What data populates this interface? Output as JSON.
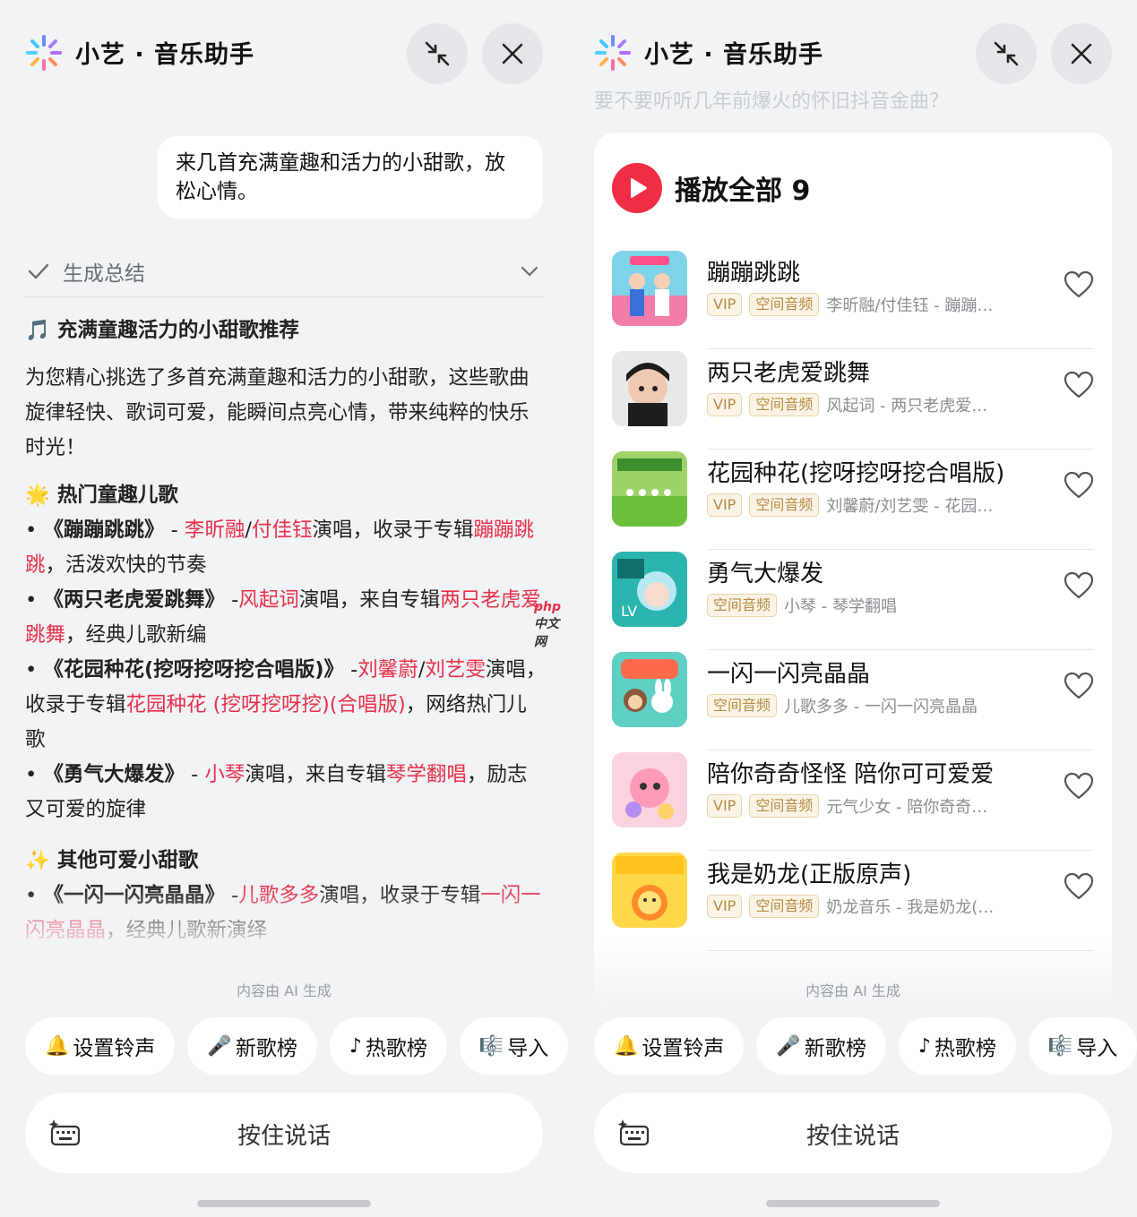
{
  "app": {
    "title": "小艺 · 音乐助手",
    "minimize_icon": "collapse-arrows-icon",
    "close_icon": "close-icon",
    "logo_icon": "sparkle-logo-icon"
  },
  "left": {
    "user_message": "来几首充满童趣和活力的小甜歌，放松心情。",
    "summary_label": "生成总结",
    "heading": "🎵 充满童趣活力的小甜歌推荐",
    "intro": "为您精心挑选了多首充满童趣和活力的小甜歌，这些歌曲旋律轻快、歌词可爱，能瞬间点亮心情，带来纯粹的快乐时光！",
    "section1_title": "🌟 热门童趣儿歌",
    "items": [
      {
        "bullet": "• ",
        "title": "《蹦蹦跳跳》",
        "dash": " - ",
        "artist1": "李昕融",
        "sep": "/",
        "artist2": "付佳钰",
        "mid": "演唱，收录于专辑",
        "album": "蹦蹦跳跳",
        "tail": "，活泼欢快的节奏"
      },
      {
        "bullet": "• ",
        "title": "《两只老虎爱跳舞》",
        "dash": " -",
        "artist1": "风起词",
        "sep": "",
        "artist2": "",
        "mid": "演唱，来自专辑",
        "album": "两只老虎爱跳舞",
        "tail": "，经典儿歌新编"
      },
      {
        "bullet": "• ",
        "title": "《花园种花(挖呀挖呀挖合唱版)》",
        "dash": " -",
        "artist1": "刘馨蔚",
        "sep": "/",
        "artist2": "刘艺雯",
        "mid": "演唱，收录于专辑",
        "album": "花园种花 (挖呀挖呀挖)(合唱版)",
        "tail": "，网络热门儿歌"
      },
      {
        "bullet": "• ",
        "title": "《勇气大爆发》",
        "dash": " - ",
        "artist1": "小琴",
        "sep": "",
        "artist2": "",
        "mid": "演唱，来自专辑",
        "album": "琴学翻唱",
        "tail": "，励志又可爱的旋律"
      }
    ],
    "section2_title": "✨ 其他可爱小甜歌",
    "items2": [
      {
        "bullet": "• ",
        "title": "《一闪一闪亮晶晶》",
        "dash": " -",
        "artist1": "儿歌多多",
        "sep": "",
        "artist2": "",
        "mid": "演唱，收录于专辑",
        "album": "一闪一闪亮晶晶",
        "tail": "，经典儿歌新演绎"
      }
    ],
    "watermark": "php",
    "watermark2": "中文网"
  },
  "right": {
    "ghost_text": "要不要听听几年前爆火的怀旧抖音金曲？",
    "play_all": "播放全部 9",
    "songs": [
      {
        "title": "蹦蹦跳跳",
        "vip": "VIP",
        "spatial": "空间音频",
        "meta": "李昕融/付佳钰 - 蹦蹦…",
        "cover": "cover-kids-dance"
      },
      {
        "title": "两只老虎爱跳舞",
        "vip": "VIP",
        "spatial": "空间音频",
        "meta": "风起词 - 两只老虎爱…",
        "cover": "cover-boy-portrait"
      },
      {
        "title": "花园种花(挖呀挖呀挖合唱版)",
        "vip": "VIP",
        "spatial": "空间音频",
        "meta": "刘馨蔚/刘艺雯 - 花园…",
        "cover": "cover-flower-garden"
      },
      {
        "title": "勇气大爆发",
        "vip": "",
        "spatial": "空间音频",
        "meta": "小琴 - 琴学翻唱",
        "cover": "cover-anime-girl"
      },
      {
        "title": "一闪一闪亮晶晶",
        "vip": "",
        "spatial": "空间音频",
        "meta": "儿歌多多 - 一闪一闪亮晶晶",
        "cover": "cover-cartoon-animals"
      },
      {
        "title": "陪你奇奇怪怪 陪你可可爱爱",
        "vip": "VIP",
        "spatial": "空间音频",
        "meta": "元气少女 - 陪你奇奇…",
        "cover": "cover-pink-cartoon"
      },
      {
        "title": "我是奶龙(正版原声)",
        "vip": "VIP",
        "spatial": "空间音频",
        "meta": "奶龙音乐 - 我是奶龙(…",
        "cover": "cover-yellow-dragon"
      }
    ]
  },
  "footer": {
    "ai_note": "内容由 AI 生成",
    "chips": [
      {
        "icon": "🔔",
        "label": "设置铃声"
      },
      {
        "icon": "🎤",
        "label": "新歌榜"
      },
      {
        "icon": "♪",
        "label": "热歌榜"
      },
      {
        "icon": "🎼",
        "label": "导入"
      }
    ],
    "push_to_talk": "按住说话",
    "keyboard_icon": "ai-keyboard-icon"
  },
  "colors": {
    "accent": "#e8304a",
    "play": "#ef2d45",
    "bg": "#f1f3f5"
  }
}
